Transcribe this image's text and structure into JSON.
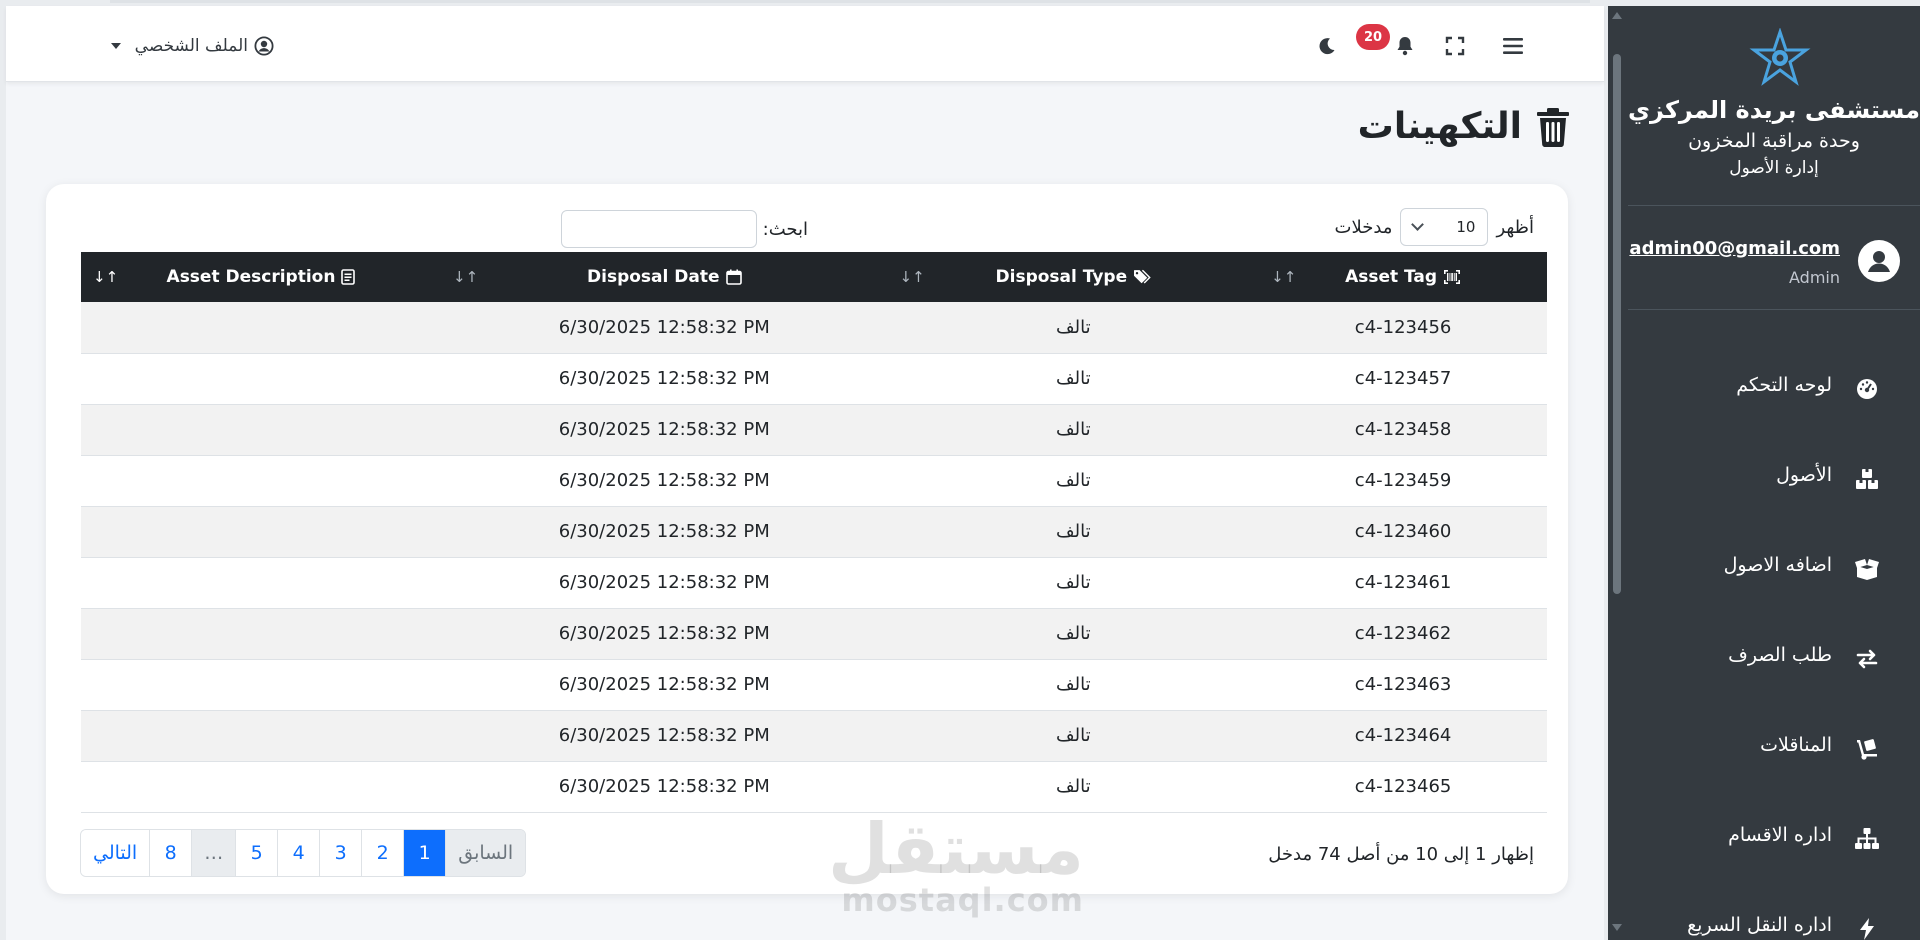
{
  "topbar": {
    "notification_count": "20",
    "profile_label": "الملف الشخصي"
  },
  "page": {
    "title": "التكهينات"
  },
  "table_controls": {
    "show_prefix": "أظهر",
    "page_length": "10",
    "show_suffix": "مدخلات",
    "search_label": "ابحث:",
    "search_value": ""
  },
  "table": {
    "columns": [
      {
        "label": "Asset Tag"
      },
      {
        "label": "Disposal Type"
      },
      {
        "label": "Disposal Date"
      },
      {
        "label": "Asset Description"
      }
    ],
    "rows": [
      {
        "tag": "c4-123456",
        "type": "تالف",
        "date": "6/30/2025 12:58:32 PM",
        "desc": ""
      },
      {
        "tag": "c4-123457",
        "type": "تالف",
        "date": "6/30/2025 12:58:32 PM",
        "desc": ""
      },
      {
        "tag": "c4-123458",
        "type": "تالف",
        "date": "6/30/2025 12:58:32 PM",
        "desc": ""
      },
      {
        "tag": "c4-123459",
        "type": "تالف",
        "date": "6/30/2025 12:58:32 PM",
        "desc": ""
      },
      {
        "tag": "c4-123460",
        "type": "تالف",
        "date": "6/30/2025 12:58:32 PM",
        "desc": ""
      },
      {
        "tag": "c4-123461",
        "type": "تالف",
        "date": "6/30/2025 12:58:32 PM",
        "desc": ""
      },
      {
        "tag": "c4-123462",
        "type": "تالف",
        "date": "6/30/2025 12:58:32 PM",
        "desc": ""
      },
      {
        "tag": "c4-123463",
        "type": "تالف",
        "date": "6/30/2025 12:58:32 PM",
        "desc": ""
      },
      {
        "tag": "c4-123464",
        "type": "تالف",
        "date": "6/30/2025 12:58:32 PM",
        "desc": ""
      },
      {
        "tag": "c4-123465",
        "type": "تالف",
        "date": "6/30/2025 12:58:32 PM",
        "desc": ""
      }
    ]
  },
  "footer": {
    "info_text": "إظهار 1 إلى 10 من أصل 74 مدخل",
    "pagination": {
      "previous": "السابق",
      "pages": [
        "1",
        "2",
        "3",
        "4",
        "5",
        "…",
        "8"
      ],
      "next": "التالي"
    }
  },
  "watermark": {
    "arabic": "مستقل",
    "latin": "mostaql.com"
  },
  "sidebar": {
    "brand_name": "مستشفى بريدة المركزي",
    "brand_unit": "وحدة مراقبة المخزون",
    "brand_dept": "إدارة الأصول",
    "user_email": "admin00@gmail.com",
    "user_role": "Admin",
    "items": [
      {
        "label": "لوحه التحكم",
        "icon": "gauge-icon"
      },
      {
        "label": "الأصول",
        "icon": "boxes-icon"
      },
      {
        "label": "اضافه الاصول",
        "icon": "box-open-icon"
      },
      {
        "label": "طلب الصرف",
        "icon": "exchange-icon"
      },
      {
        "label": "المناقلات",
        "icon": "dolly-icon"
      },
      {
        "label": "اداره الاقسام",
        "icon": "sitemap-icon"
      },
      {
        "label": "اداره النقل السريع",
        "icon": "bolt-icon"
      }
    ]
  },
  "colors": {
    "sidebar_bg": "#343a40",
    "table_header_bg": "#212529",
    "accent": "#0d6efd",
    "badge": "#dc3545"
  }
}
